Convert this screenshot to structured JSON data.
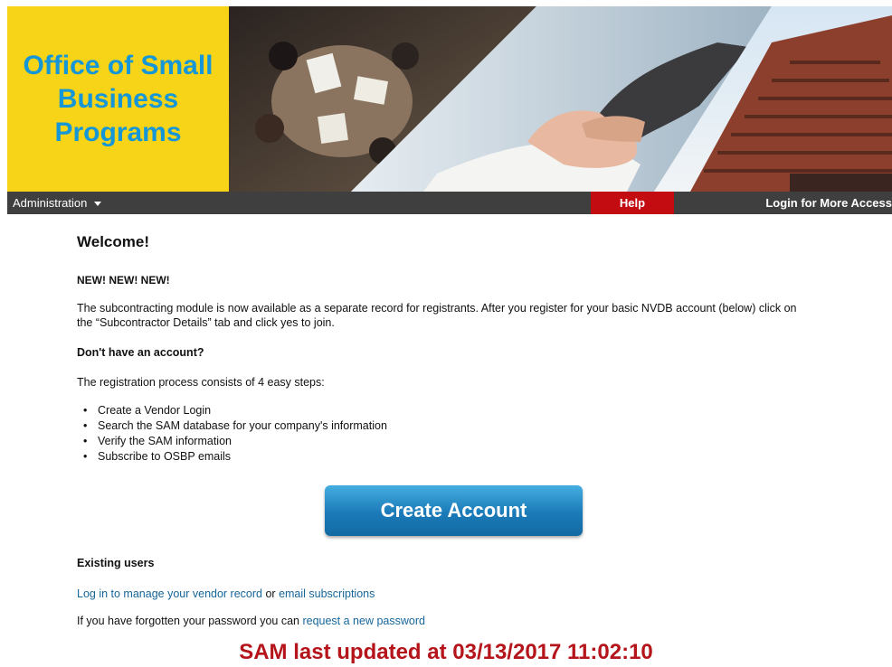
{
  "banner": {
    "logo_line1": "Office of Small",
    "logo_line2": "Business",
    "logo_line3": "Programs"
  },
  "nav": {
    "administration": "Administration",
    "help": "Help",
    "login": "Login for More Access"
  },
  "main": {
    "welcome": "Welcome!",
    "new_heading": "NEW! NEW! NEW!",
    "subcontract_text": "The subcontracting module is now available as a separate record for registrants. After you register for your basic NVDB account (below) click on the “Subcontractor Details” tab and click yes to join.",
    "no_account_heading": "Don't have an account?",
    "steps_intro": "The registration process consists of 4 easy steps:",
    "steps": [
      "Create a Vendor Login",
      "Search the SAM database for your company's information",
      "Verify the SAM information",
      "Subscribe to OSBP emails"
    ],
    "create_account_button": "Create Account",
    "existing_heading": "Existing users",
    "login_link": "Log in to manage your vendor record",
    "or_text": " or ",
    "email_link": "email subscriptions",
    "forgot_text": "If you have forgotten your password you can ",
    "reset_link": "request a new password",
    "sam_updated": "SAM last updated at 03/13/2017 11:02:10"
  },
  "colors": {
    "logo_background": "#f7d418",
    "logo_text": "#1596d6",
    "nav_background": "#3f3f3f",
    "help_background": "#c20c12",
    "link": "#16669b",
    "sam_text": "#b4141a",
    "button": "#1a7ab8"
  }
}
